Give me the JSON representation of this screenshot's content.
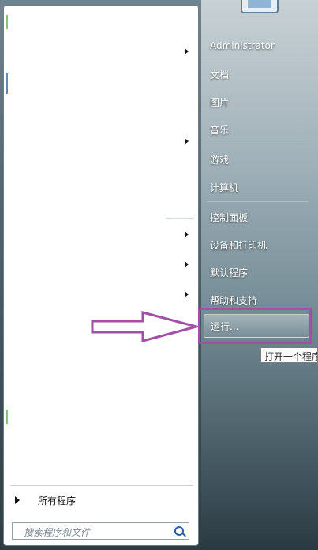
{
  "right_pane": {
    "user": "Administrator",
    "items": [
      "文档",
      "图片",
      "音乐",
      "游戏",
      "计算机",
      "控制面板",
      "设备和打印机",
      "默认程序",
      "帮助和支持"
    ],
    "run_label": "运行...",
    "tooltip": "打开一个程序"
  },
  "left_pane": {
    "all_programs": "所有程序",
    "search_placeholder": "搜索程序和文件"
  },
  "colors": {
    "highlight": "#a24fa6",
    "annotation_arrow": "#a24fa6"
  },
  "icons": [
    "flag-icon",
    "search-icon",
    "submenu-arrow-icon",
    "all-programs-arrow-icon"
  ]
}
